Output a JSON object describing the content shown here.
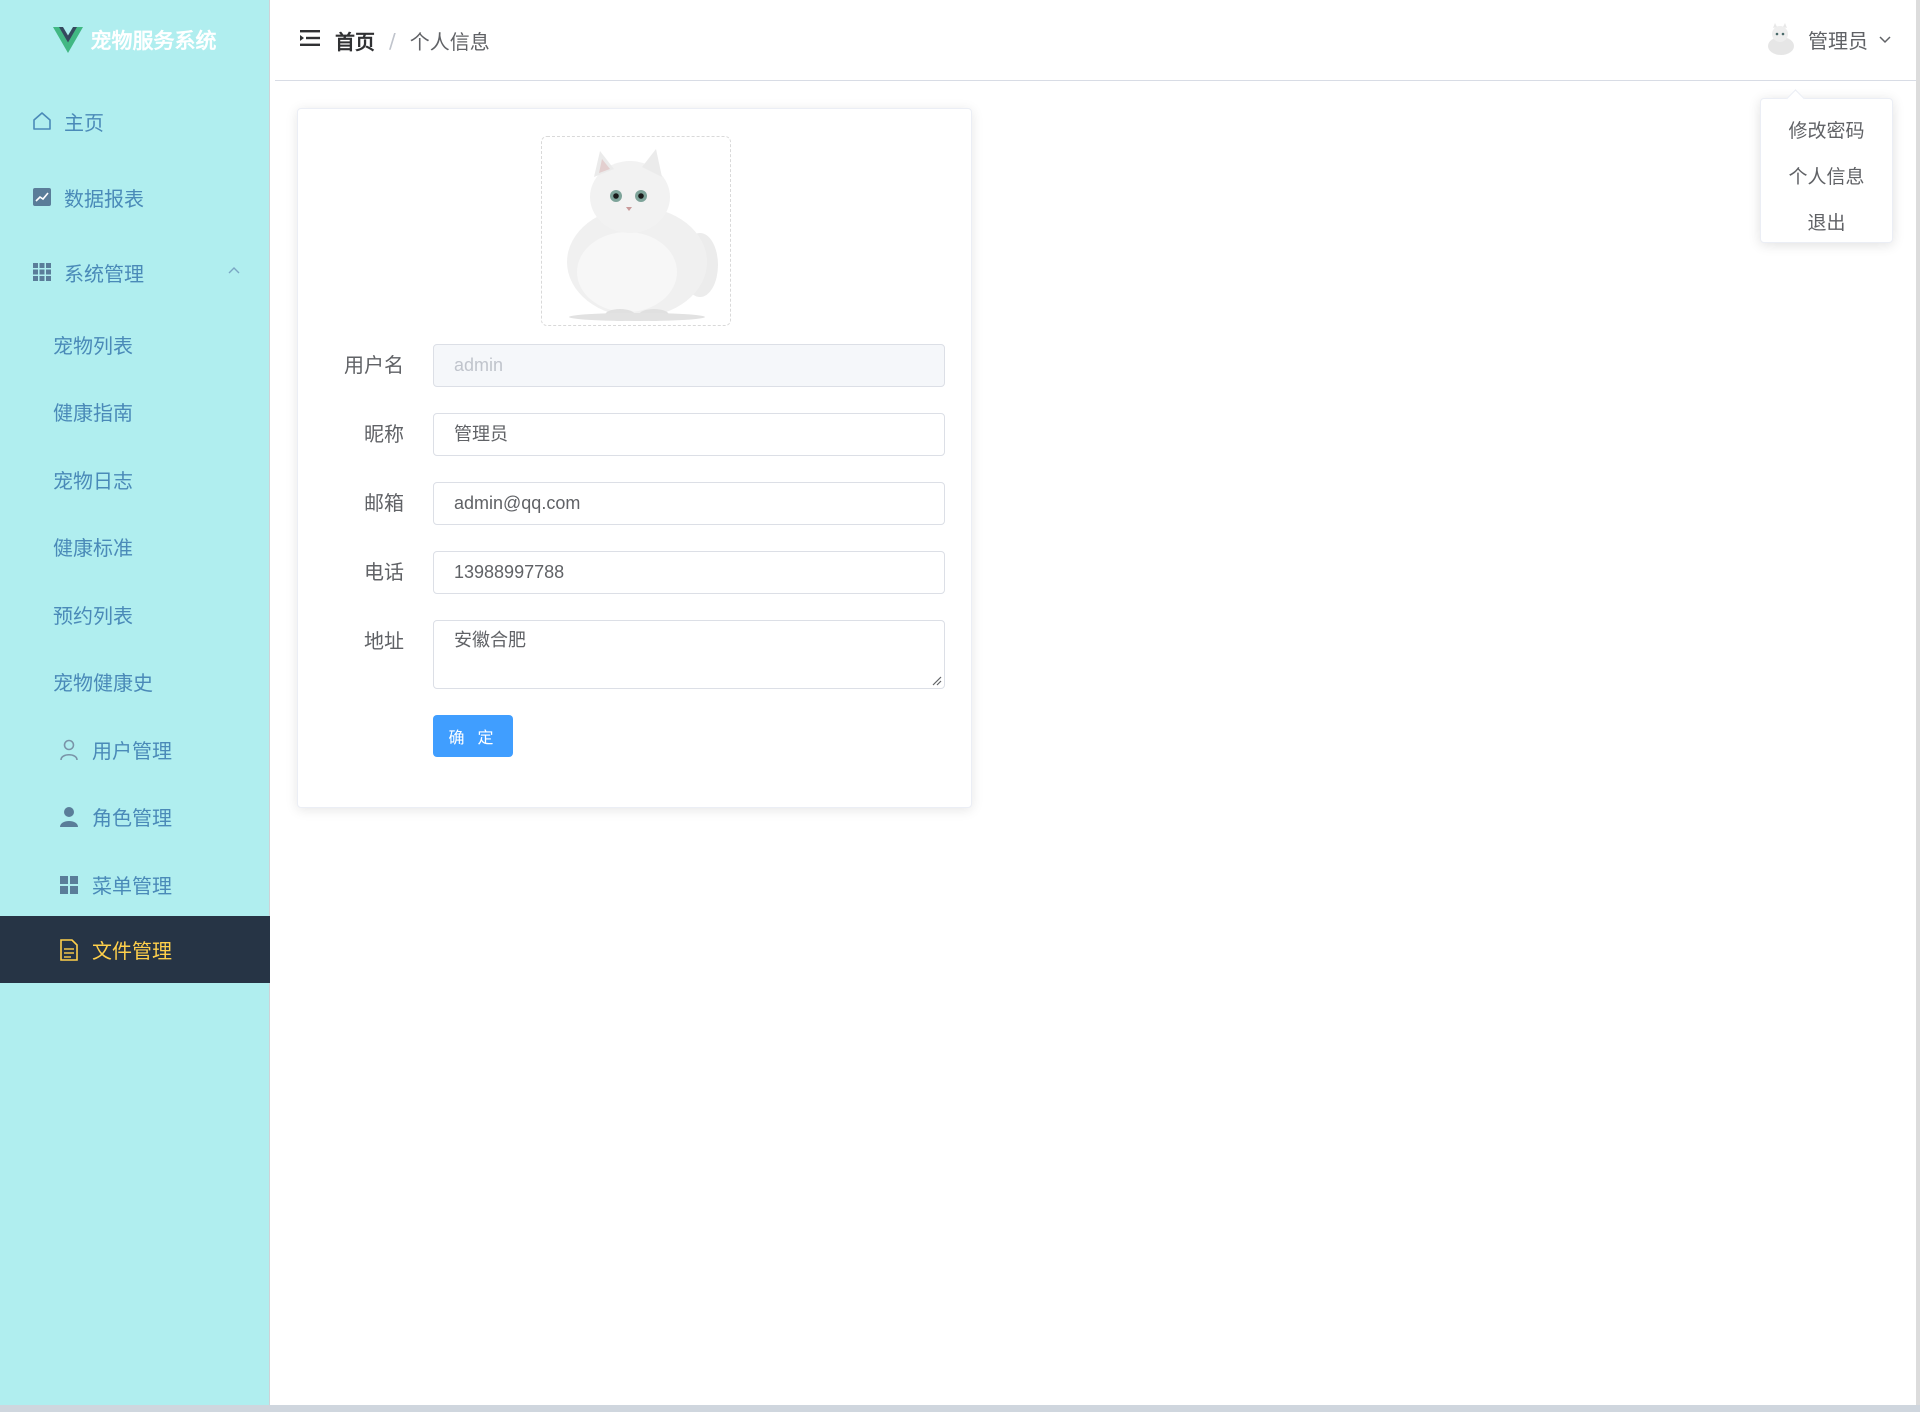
{
  "app": {
    "title": "宠物服务系统"
  },
  "sidebar": {
    "items": [
      {
        "label": "主页",
        "icon": "home-icon"
      },
      {
        "label": "数据报表",
        "icon": "chart-icon"
      },
      {
        "label": "系统管理",
        "icon": "grid-icon",
        "expanded": true
      }
    ],
    "subitems": [
      {
        "label": "宠物列表"
      },
      {
        "label": "健康指南"
      },
      {
        "label": "宠物日志"
      },
      {
        "label": "健康标准"
      },
      {
        "label": "预约列表"
      },
      {
        "label": "宠物健康史"
      },
      {
        "label": "用户管理",
        "icon": "user-icon"
      },
      {
        "label": "角色管理",
        "icon": "user-filled-icon"
      },
      {
        "label": "菜单管理",
        "icon": "menu-icon"
      },
      {
        "label": "文件管理",
        "icon": "document-icon",
        "active": true
      }
    ]
  },
  "header": {
    "breadcrumb": {
      "home": "首页",
      "separator": "/",
      "current": "个人信息"
    },
    "user": {
      "name": "管理员"
    }
  },
  "dropdown": {
    "items": [
      "修改密码",
      "个人信息",
      "退出"
    ]
  },
  "form": {
    "username_label": "用户名",
    "username_value": "admin",
    "nickname_label": "昵称",
    "nickname_value": "管理员",
    "email_label": "邮箱",
    "email_value": "admin@qq.com",
    "phone_label": "电话",
    "phone_value": "13988997788",
    "address_label": "地址",
    "address_value": "安徽合肥",
    "submit_label": "确 定"
  },
  "colors": {
    "sidebar_bg": "#b0eeef",
    "sidebar_text": "#4a8ab8",
    "active_bg": "#263445",
    "active_text": "#ffd04b",
    "primary": "#409eff"
  }
}
